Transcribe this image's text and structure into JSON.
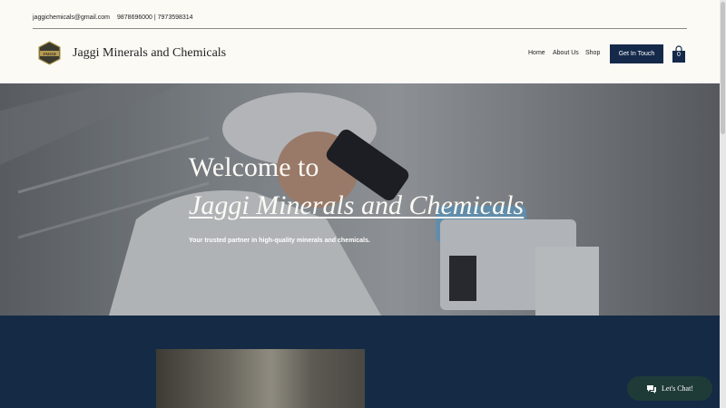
{
  "topbar": {
    "email": "jaggichemicals@gmail.com",
    "phones": "9878696000 | 7973598314"
  },
  "header": {
    "brand": "Jaggi Minerals and Chemicals",
    "logo_text": "JAGGI",
    "nav": [
      "Home",
      "About Us",
      "Shop"
    ],
    "cta": "Get In Touch",
    "cart_count": "0"
  },
  "hero": {
    "title_line1": "Welcome to",
    "title_line2": "Jaggi Minerals and Chemicals",
    "subtitle": "Your trusted partner in high-quality minerals and chemicals."
  },
  "chat": {
    "label": "Let's Chat!"
  },
  "colors": {
    "navy": "#15294a",
    "cream": "#fbfaf5",
    "chat_green": "#1f3b38"
  }
}
